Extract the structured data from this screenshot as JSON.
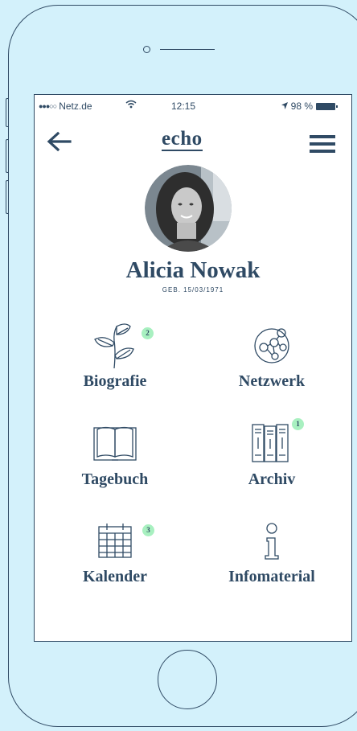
{
  "status_bar": {
    "carrier": "Netz.de",
    "time": "12:15",
    "battery": "98 %"
  },
  "header": {
    "logo": "echo"
  },
  "profile": {
    "name": "Alicia Nowak",
    "dob": "GEB. 15/03/1971"
  },
  "tiles": [
    {
      "label": "Biografie",
      "badge": "2"
    },
    {
      "label": "Netzwerk",
      "badge": ""
    },
    {
      "label": "Tagebuch",
      "badge": ""
    },
    {
      "label": "Archiv",
      "badge": "1"
    },
    {
      "label": "Kalender",
      "badge": "3"
    },
    {
      "label": "Infomaterial",
      "badge": ""
    }
  ],
  "colors": {
    "background": "#d3f1fb",
    "ink": "#2f4a64",
    "badge": "#a8f0c0",
    "screen": "#ffffff"
  },
  "icons": [
    "arrow-left-icon",
    "hamburger-menu-icon",
    "leaves-icon",
    "network-icon",
    "book-icon",
    "books-icon",
    "calendar-icon",
    "info-icon",
    "wifi-icon",
    "location-icon",
    "battery-icon"
  ]
}
